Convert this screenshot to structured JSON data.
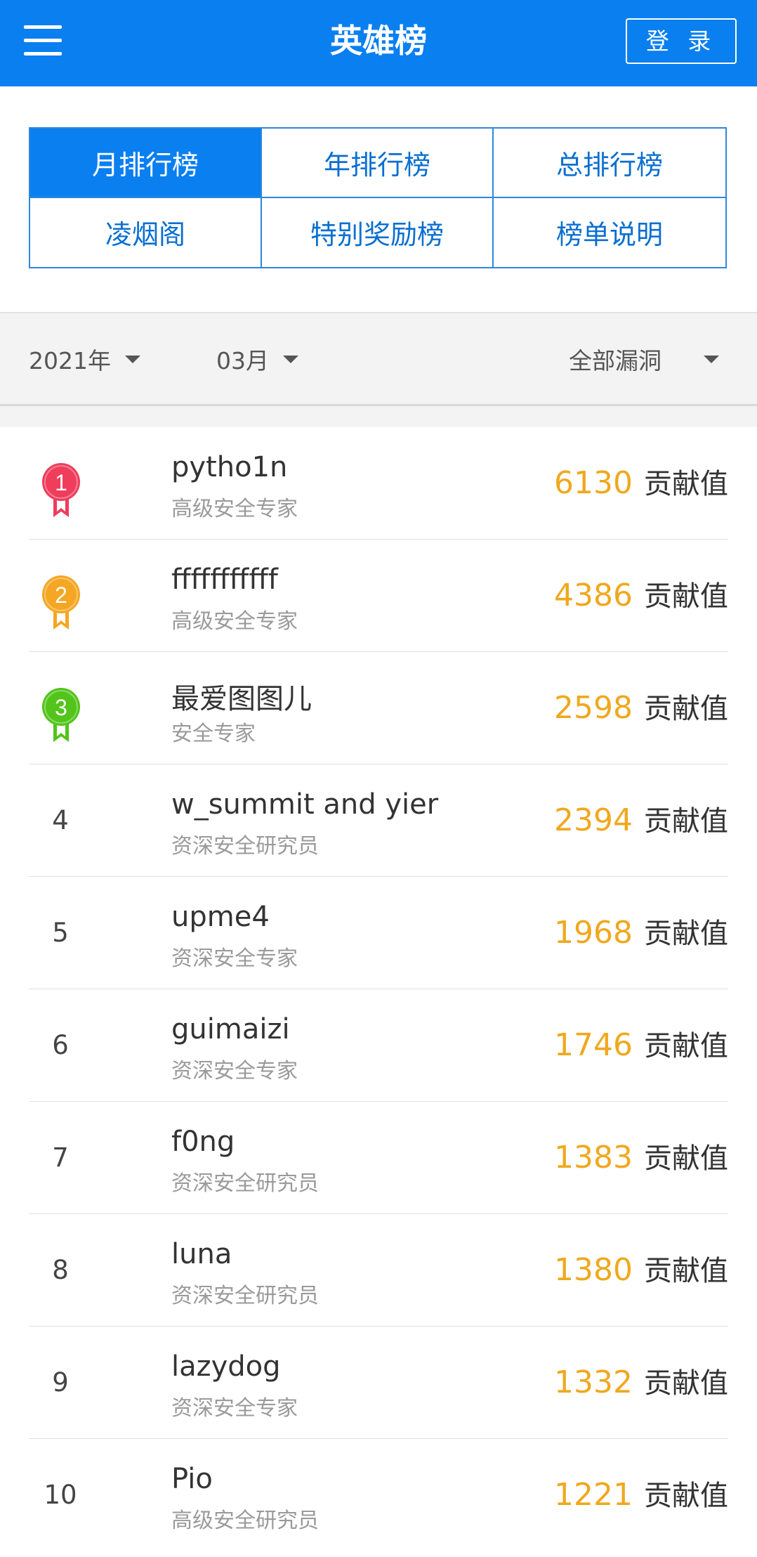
{
  "header": {
    "title": "英雄榜",
    "login_label": "登 录"
  },
  "tabs": [
    {
      "label": "月排行榜",
      "active": true
    },
    {
      "label": "年排行榜",
      "active": false
    },
    {
      "label": "总排行榜",
      "active": false
    },
    {
      "label": "凌烟阁",
      "active": false
    },
    {
      "label": "特别奖励榜",
      "active": false
    },
    {
      "label": "榜单说明",
      "active": false
    }
  ],
  "filters": {
    "year": "2021年",
    "month": "03月",
    "category": "全部漏洞"
  },
  "score_unit": "贡献值",
  "colors": {
    "brand": "#0a7ff0",
    "score": "#f0a81e",
    "medal_gold": "#ef3d5b",
    "medal_silver": "#f5a623",
    "medal_bronze": "#52c41a"
  },
  "leaderboard": [
    {
      "rank": "1",
      "name": "pytho1n",
      "level": "高级安全专家",
      "score": "6130",
      "medal": "medal-rank-1-icon"
    },
    {
      "rank": "2",
      "name": "fffffffffff",
      "level": "高级安全专家",
      "score": "4386",
      "medal": "medal-rank-2-icon"
    },
    {
      "rank": "3",
      "name": "最爱图图儿",
      "level": "安全专家",
      "score": "2598",
      "medal": "medal-rank-3-icon"
    },
    {
      "rank": "4",
      "name": "w_summit and yier",
      "level": "资深安全研究员",
      "score": "2394"
    },
    {
      "rank": "5",
      "name": "upme4",
      "level": "资深安全专家",
      "score": "1968"
    },
    {
      "rank": "6",
      "name": "guimaizi",
      "level": "资深安全专家",
      "score": "1746"
    },
    {
      "rank": "7",
      "name": "f0ng",
      "level": "资深安全研究员",
      "score": "1383"
    },
    {
      "rank": "8",
      "name": "luna",
      "level": "资深安全研究员",
      "score": "1380"
    },
    {
      "rank": "9",
      "name": "lazydog",
      "level": "资深安全专家",
      "score": "1332"
    },
    {
      "rank": "10",
      "name": "Pio",
      "level": "高级安全研究员",
      "score": "1221"
    }
  ]
}
